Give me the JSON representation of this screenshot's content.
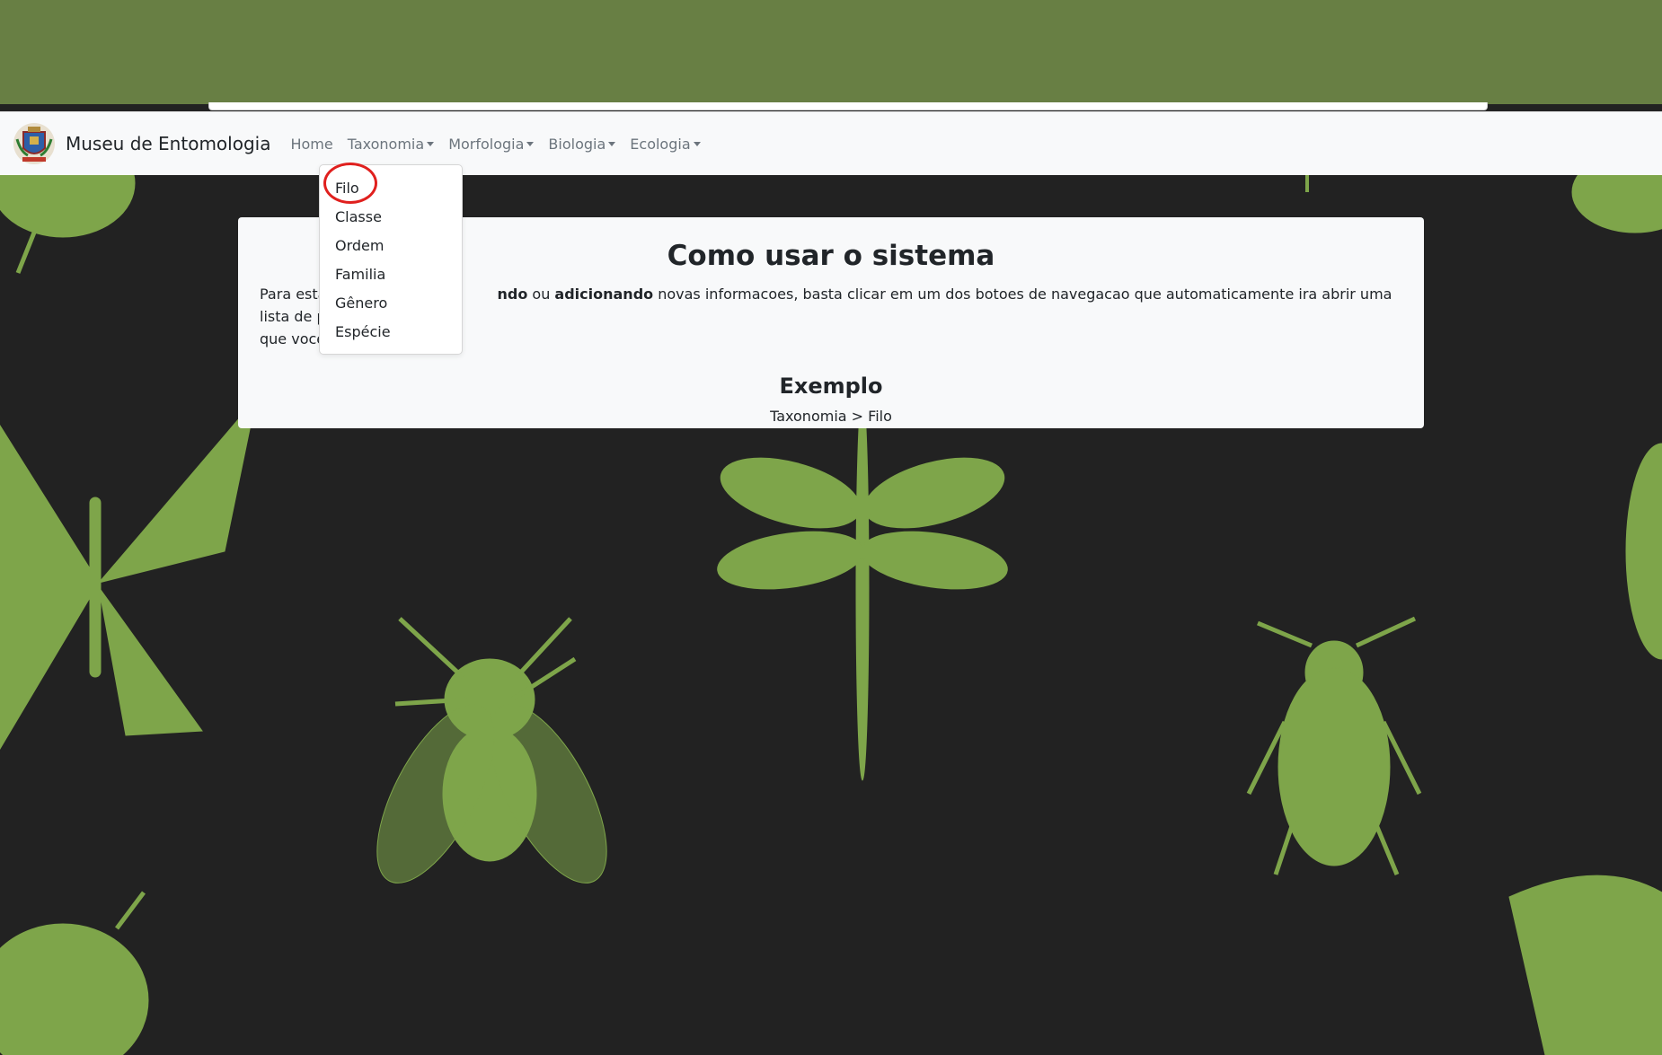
{
  "navbar": {
    "brand": "Museu de Entomologia",
    "items": [
      {
        "label": "Home",
        "has_caret": false
      },
      {
        "label": "Taxonomia",
        "has_caret": true
      },
      {
        "label": "Morfologia",
        "has_caret": true
      },
      {
        "label": "Biologia",
        "has_caret": true
      },
      {
        "label": "Ecologia",
        "has_caret": true
      }
    ]
  },
  "dropdown": {
    "items": [
      "Filo",
      "Classe",
      "Ordem",
      "Familia",
      "Gênero",
      "Espécie"
    ]
  },
  "card": {
    "title": "Como usar o sistema",
    "intro_start": "Para esta",
    "intro_bold1": "ndo",
    "intro_mid": " ou ",
    "intro_bold2": "adicionando",
    "intro_rest": " novas informacoes, basta clicar em um dos botoes de navegacao que automaticamente ira abrir uma lista de propriedade",
    "intro_line2": "que voce",
    "example_title": "Exemplo",
    "example_path": "Taxonomia > Filo"
  },
  "colors": {
    "top_band": "#687f44",
    "insect_green": "#7ea54a",
    "background": "#222222",
    "highlight_ring": "#e0201e"
  },
  "icons": [
    "coat-of-arms-logo",
    "caret-down-icon"
  ]
}
